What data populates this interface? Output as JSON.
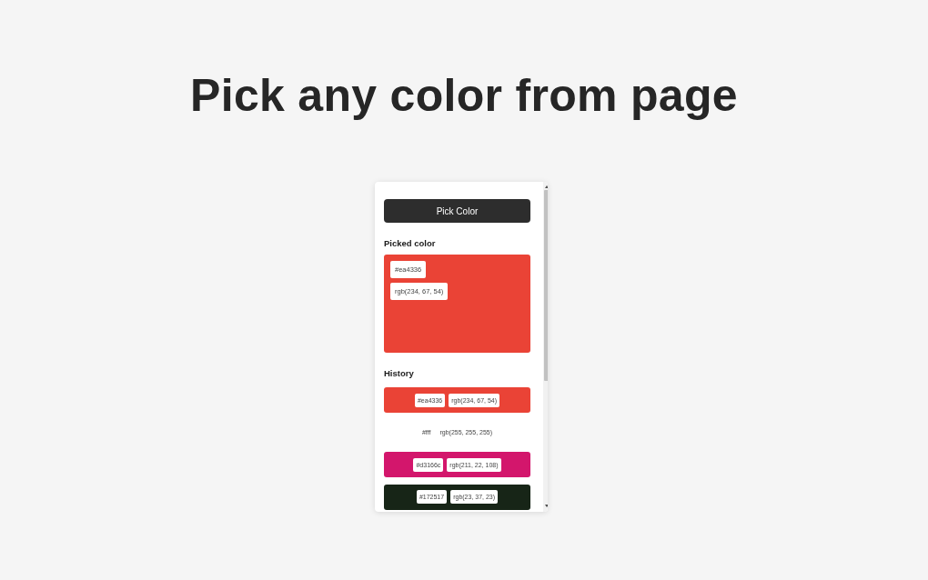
{
  "headline": "Pick any color from page",
  "popup": {
    "pick_button": "Pick Color",
    "picked": {
      "label": "Picked color",
      "color": "#ea4336",
      "hex": "#ea4336",
      "rgb": "rgb(234, 67, 54)"
    },
    "history": {
      "label": "History",
      "items": [
        {
          "color": "#ea4336",
          "hex": "#ea4336",
          "rgb": "rgb(234, 67, 54)"
        },
        {
          "color": "#ffffff",
          "hex": "#fff",
          "rgb": "rgb(255, 255, 255)"
        },
        {
          "color": "#d3166c",
          "hex": "#d3166c",
          "rgb": "rgb(211, 22, 108)"
        },
        {
          "color": "#172517",
          "hex": "#172517",
          "rgb": "rgb(23, 37, 23)"
        }
      ]
    }
  }
}
